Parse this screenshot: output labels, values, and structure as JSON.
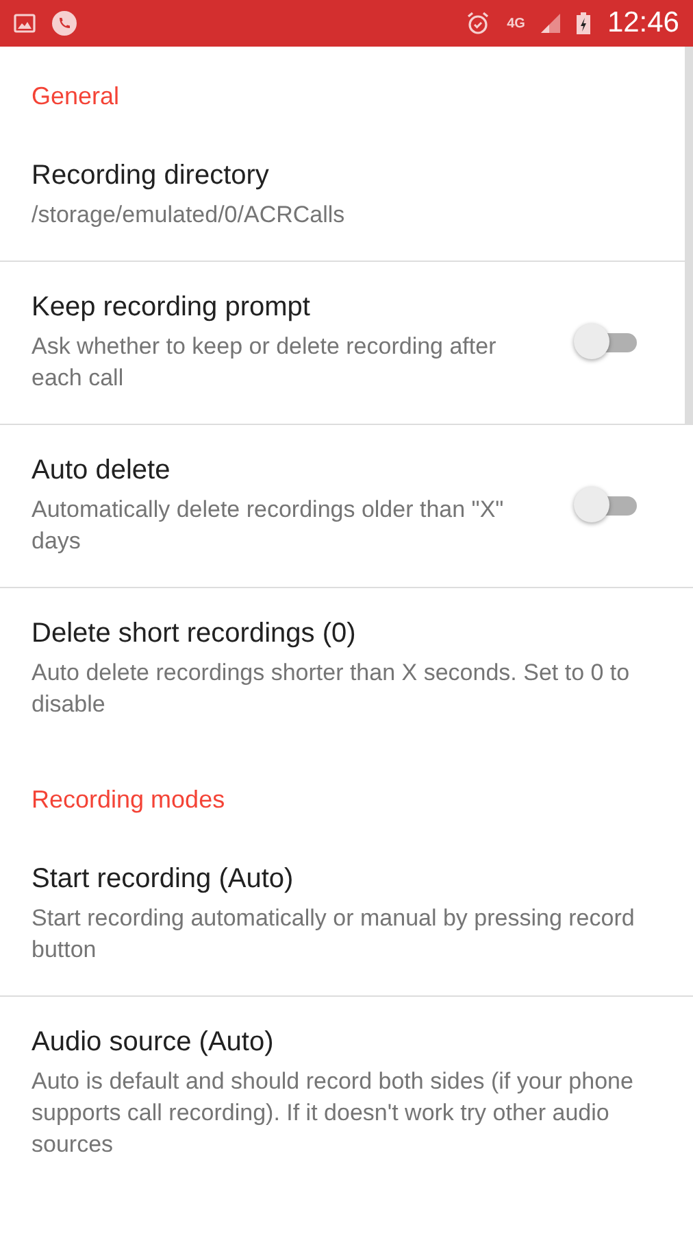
{
  "status_bar": {
    "network_type": "4G",
    "time": "12:46"
  },
  "sections": [
    {
      "header": "General",
      "items": [
        {
          "kind": "text",
          "title": "Recording directory",
          "summary": "/storage/emulated/0/ACRCalls"
        },
        {
          "kind": "switch",
          "title": "Keep recording prompt",
          "summary": "Ask whether to keep or delete recording after each call",
          "on": false
        },
        {
          "kind": "switch",
          "title": "Auto delete",
          "summary": "Automatically delete recordings older than \"X\" days",
          "on": false
        },
        {
          "kind": "text",
          "title": "Delete short recordings (0)",
          "summary": "Auto delete recordings shorter than X seconds. Set to 0 to disable"
        }
      ]
    },
    {
      "header": "Recording modes",
      "items": [
        {
          "kind": "text",
          "title": "Start recording (Auto)",
          "summary": "Start recording automatically or manual by pressing record button"
        },
        {
          "kind": "text",
          "title": "Audio source (Auto)",
          "summary": "Auto is default and should record both sides (if your phone supports call recording). If it doesn't work try other audio sources"
        }
      ]
    }
  ]
}
